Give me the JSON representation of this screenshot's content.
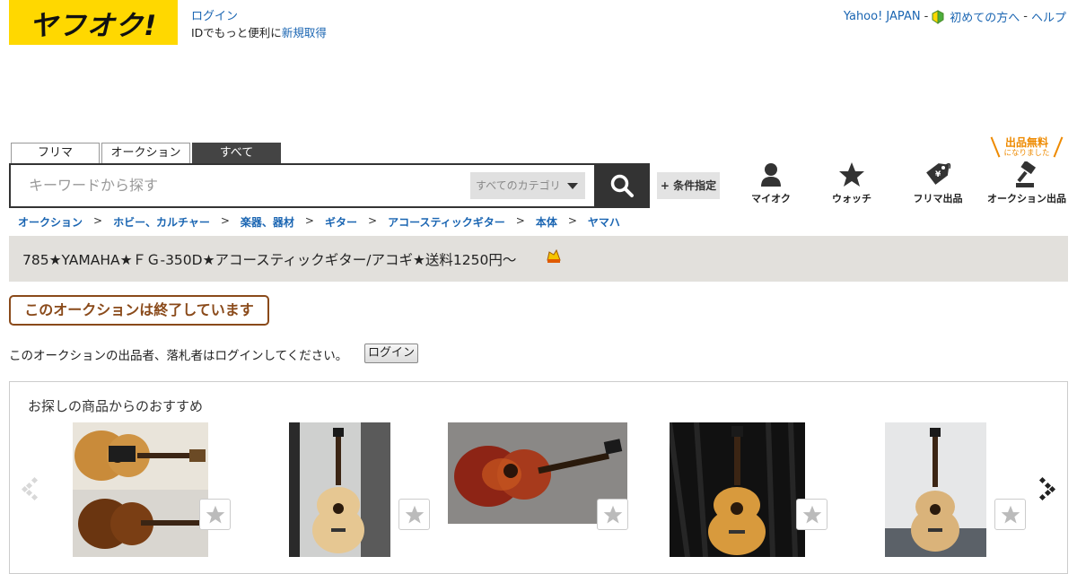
{
  "header": {
    "logo_text": "ヤフオク!",
    "login_link": "ログイン",
    "login_sub_prefix": "IDでもっと便利に",
    "signup_link": "新規取得",
    "top_links": {
      "yahoo_japan": "Yahoo! JAPAN",
      "sep1": "-",
      "beginners": "初めての方へ",
      "sep2": "-",
      "help": "ヘルプ"
    }
  },
  "search": {
    "tabs": [
      "フリマ",
      "オークション",
      "すべて"
    ],
    "active_tab": "すべて",
    "placeholder": "キーワードから探す",
    "category": "すべてのカテゴリ",
    "condition_button": "+ 条件指定"
  },
  "nav": {
    "free_badge_main": "出品無料",
    "free_badge_sub": "になりました",
    "items": [
      {
        "label": "マイオク",
        "icon": "user-icon"
      },
      {
        "label": "ウォッチ",
        "icon": "star-icon"
      },
      {
        "label": "フリマ出品",
        "icon": "price-tag-icon"
      },
      {
        "label": "オークション出品",
        "icon": "gavel-icon"
      }
    ]
  },
  "breadcrumb": [
    "オークション",
    "ホビー、カルチャー",
    "楽器、器材",
    "ギター",
    "アコースティックギター",
    "本体",
    "ヤマハ"
  ],
  "breadcrumb_sep": ">",
  "item": {
    "title": "785★YAMAHA★ＦＧ-350D★アコースティックギター/アコギ★送料1250円～",
    "ended_label": "このオークションは終了しています",
    "notice": "このオークションの出品者、落札者はログインしてください。",
    "notice_button": "ログイン"
  },
  "recommend": {
    "title": "お探しの商品からのおすすめ"
  },
  "colors": {
    "brand_yellow": "#ffd800",
    "link_blue": "#1a65b2",
    "ended_brown": "#8a4a1a",
    "free_orange": "#ee8a00"
  }
}
